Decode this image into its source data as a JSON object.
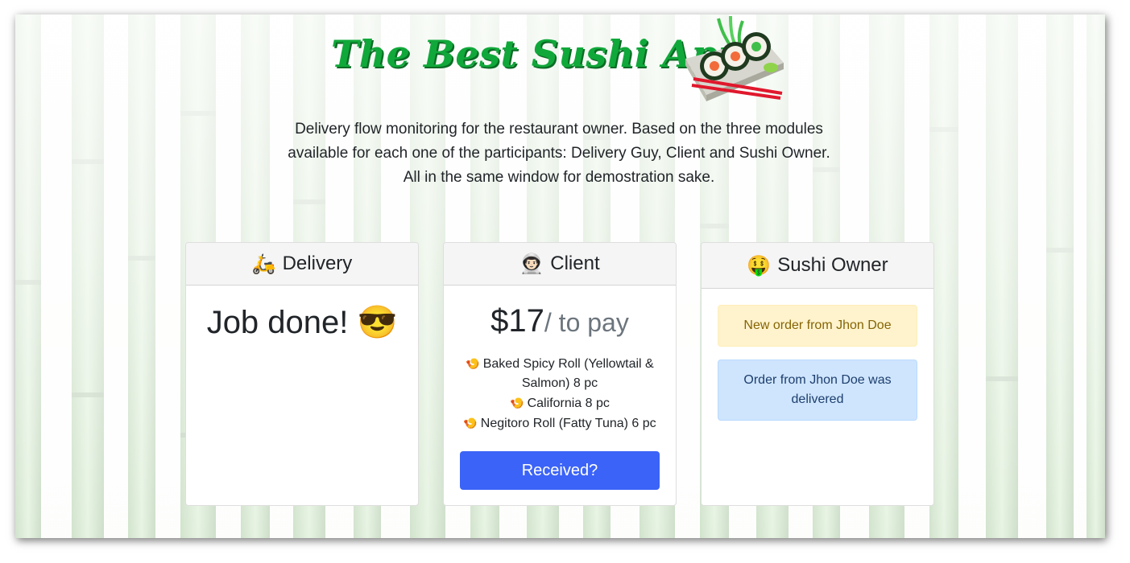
{
  "header": {
    "title": "The Best Sushi App",
    "description": "Delivery flow monitoring for the restaurant owner. Based on the three modules available for each one of the participants: Delivery Guy, Client and Sushi Owner. All in the same window for demostration sake."
  },
  "delivery": {
    "emoji": "🛵",
    "title": "Delivery",
    "status": "Job done! 😎"
  },
  "client": {
    "emoji": "👨🏻‍🚀",
    "title": "Client",
    "amount": "$17",
    "amount_suffix": "/ to pay",
    "item_icon": "🍤",
    "items": [
      "Baked Spicy Roll (Yellowtail & Salmon) 8 pc",
      "California 8 pc",
      "Negitoro Roll (Fatty Tuna) 6 pc"
    ],
    "button_label": "Received?"
  },
  "owner": {
    "emoji": "🤑",
    "title": "Sushi Owner",
    "notices": [
      "New order from Jhon Doe",
      "Order from Jhon Doe was delivered"
    ]
  },
  "colors": {
    "title_green": "#10a83a",
    "button_blue": "#3b63f7",
    "warning_bg": "#fff3cd",
    "info_bg": "#cfe5fd"
  }
}
